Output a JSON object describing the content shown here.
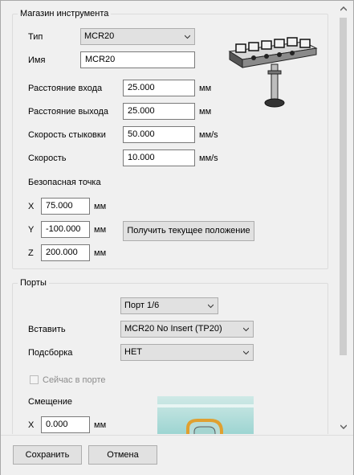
{
  "tool_magazine": {
    "title": "Магазин инструмента",
    "type_label": "Тип",
    "type_value": "MCR20",
    "name_label": "Имя",
    "name_value": "MCR20",
    "entry_label": "Расстояние входа",
    "entry_value": "25.000",
    "entry_unit": "мм",
    "exit_label": "Расстояние выхода",
    "exit_value": "25.000",
    "exit_unit": "мм",
    "dock_speed_label": "Скорость стыковки",
    "dock_speed_value": "50.000",
    "dock_speed_unit": "мм/s",
    "speed_label": "Скорость",
    "speed_value": "10.000",
    "speed_unit": "мм/s",
    "safe_point_label": "Безопасная точка",
    "x_label": "X",
    "x_value": "75.000",
    "x_unit": "мм",
    "y_label": "Y",
    "y_value": "-100.000",
    "y_unit": "мм",
    "z_label": "Z",
    "z_value": "200.000",
    "z_unit": "мм",
    "get_position_label": "Получить текущее положение"
  },
  "ports": {
    "title": "Порты",
    "port_select": "Порт 1/6",
    "insert_label": "Вставить",
    "insert_value": "MCR20 No Insert (TP20)",
    "pickup_label": "Подсборка",
    "pickup_value": "НЕТ",
    "in_port_label": "Сейчас в порте",
    "offset_label": "Смещение",
    "offset_x_label": "X",
    "offset_x_value": "0.000",
    "offset_x_unit": "мм"
  },
  "footer": {
    "save_label": "Сохранить",
    "cancel_label": "Отмена"
  },
  "colors": {
    "window_bg": "#f0f0f0",
    "button_bg": "#e1e1e1",
    "preview_teal": "#9ed3d3",
    "insert_ring": "#e0a030"
  }
}
